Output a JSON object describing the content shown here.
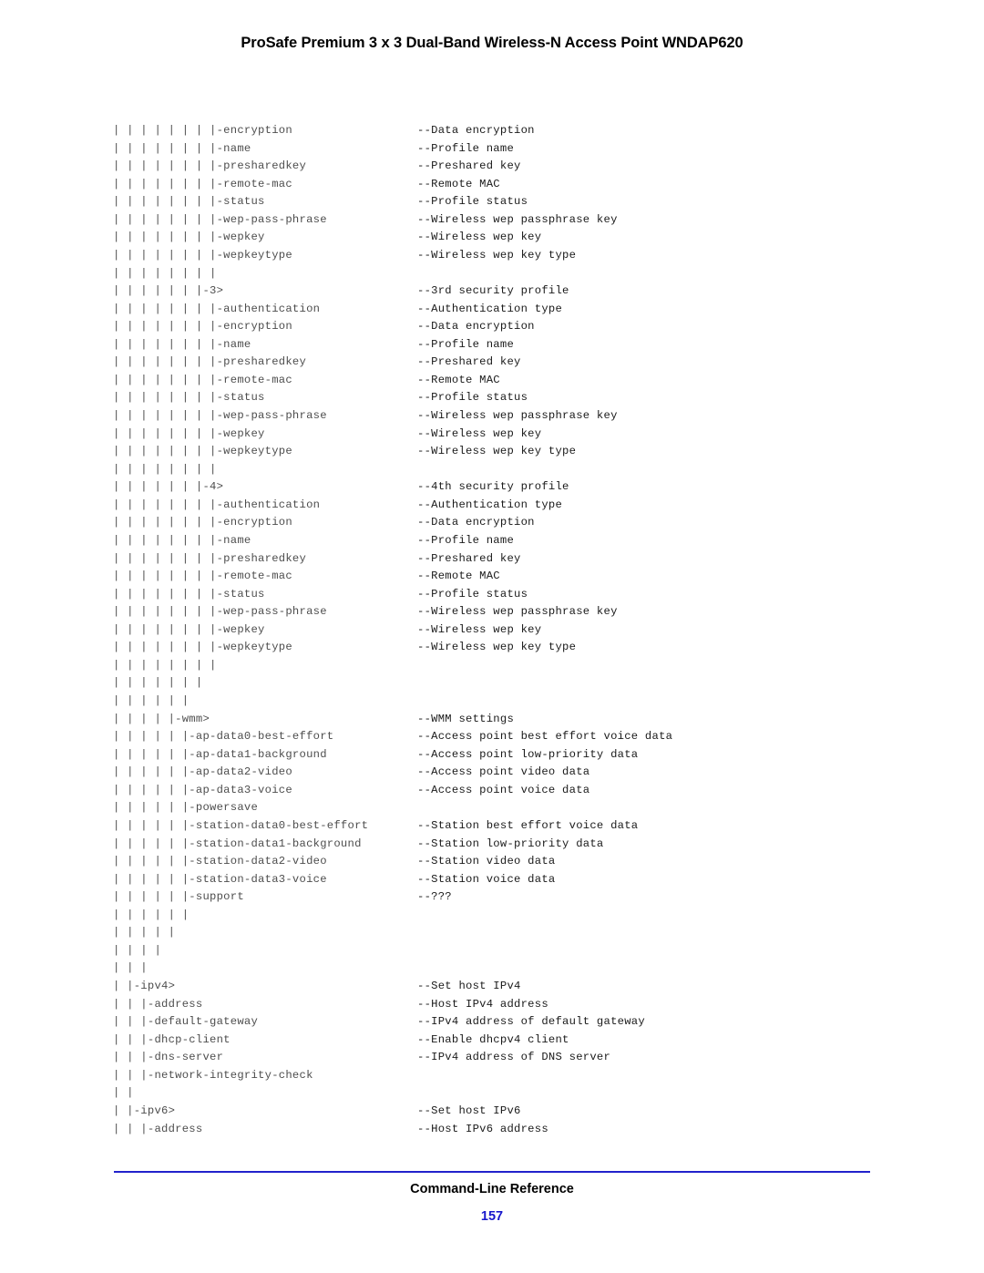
{
  "header": {
    "title": "ProSafe Premium 3 x 3 Dual-Band Wireless-N Access Point WNDAP620"
  },
  "footer": {
    "title": "Command-Line Reference",
    "page_number": "157",
    "rule_color": "#2222cc",
    "page_number_color": "#1717cc"
  },
  "tree": {
    "indent_unit": "| ",
    "branch_prefix": "|",
    "description_prefix": "--",
    "lines": [
      {
        "depth": 8,
        "label": "-encryption",
        "desc": "--Data encryption"
      },
      {
        "depth": 8,
        "label": "-name",
        "desc": "--Profile name"
      },
      {
        "depth": 8,
        "label": "-presharedkey",
        "desc": "--Preshared key"
      },
      {
        "depth": 8,
        "label": "-remote-mac",
        "desc": "--Remote MAC"
      },
      {
        "depth": 8,
        "label": "-status",
        "desc": "--Profile status"
      },
      {
        "depth": 8,
        "label": "-wep-pass-phrase",
        "desc": "--Wireless wep passphrase key"
      },
      {
        "depth": 8,
        "label": "-wepkey",
        "desc": "--Wireless wep key"
      },
      {
        "depth": 8,
        "label": "-wepkeytype",
        "desc": "--Wireless wep key type"
      },
      {
        "depth": 8,
        "label": "",
        "desc": ""
      },
      {
        "depth": 7,
        "label": "-3>",
        "desc": "--3rd security profile"
      },
      {
        "depth": 8,
        "label": "-authentication",
        "desc": "--Authentication type"
      },
      {
        "depth": 8,
        "label": "-encryption",
        "desc": "--Data encryption"
      },
      {
        "depth": 8,
        "label": "-name",
        "desc": "--Profile name"
      },
      {
        "depth": 8,
        "label": "-presharedkey",
        "desc": "--Preshared key"
      },
      {
        "depth": 8,
        "label": "-remote-mac",
        "desc": "--Remote MAC"
      },
      {
        "depth": 8,
        "label": "-status",
        "desc": "--Profile status"
      },
      {
        "depth": 8,
        "label": "-wep-pass-phrase",
        "desc": "--Wireless wep passphrase key"
      },
      {
        "depth": 8,
        "label": "-wepkey",
        "desc": "--Wireless wep key"
      },
      {
        "depth": 8,
        "label": "-wepkeytype",
        "desc": "--Wireless wep key type"
      },
      {
        "depth": 8,
        "label": "",
        "desc": ""
      },
      {
        "depth": 7,
        "label": "-4>",
        "desc": "--4th security profile"
      },
      {
        "depth": 8,
        "label": "-authentication",
        "desc": "--Authentication type"
      },
      {
        "depth": 8,
        "label": "-encryption",
        "desc": "--Data encryption"
      },
      {
        "depth": 8,
        "label": "-name",
        "desc": "--Profile name"
      },
      {
        "depth": 8,
        "label": "-presharedkey",
        "desc": "--Preshared key"
      },
      {
        "depth": 8,
        "label": "-remote-mac",
        "desc": "--Remote MAC"
      },
      {
        "depth": 8,
        "label": "-status",
        "desc": "--Profile status"
      },
      {
        "depth": 8,
        "label": "-wep-pass-phrase",
        "desc": "--Wireless wep passphrase key"
      },
      {
        "depth": 8,
        "label": "-wepkey",
        "desc": "--Wireless wep key"
      },
      {
        "depth": 8,
        "label": "-wepkeytype",
        "desc": "--Wireless wep key type"
      },
      {
        "depth": 8,
        "label": "",
        "desc": ""
      },
      {
        "depth": 7,
        "label": "",
        "desc": ""
      },
      {
        "depth": 6,
        "label": "",
        "desc": ""
      },
      {
        "depth": 5,
        "label": "-wmm>",
        "desc": "--WMM settings"
      },
      {
        "depth": 6,
        "label": "-ap-data0-best-effort",
        "desc": "--Access point best effort voice data"
      },
      {
        "depth": 6,
        "label": "-ap-data1-background",
        "desc": "--Access point low-priority data"
      },
      {
        "depth": 6,
        "label": "-ap-data2-video",
        "desc": "--Access point video data"
      },
      {
        "depth": 6,
        "label": "-ap-data3-voice",
        "desc": "--Access point voice data"
      },
      {
        "depth": 6,
        "label": "-powersave",
        "desc": ""
      },
      {
        "depth": 6,
        "label": "-station-data0-best-effort",
        "desc": "--Station best effort voice data"
      },
      {
        "depth": 6,
        "label": "-station-data1-background",
        "desc": "--Station low-priority data"
      },
      {
        "depth": 6,
        "label": "-station-data2-video",
        "desc": "--Station video data"
      },
      {
        "depth": 6,
        "label": "-station-data3-voice",
        "desc": "--Station voice data"
      },
      {
        "depth": 6,
        "label": "-support",
        "desc": "--???"
      },
      {
        "depth": 6,
        "label": "",
        "desc": ""
      },
      {
        "depth": 5,
        "label": "",
        "desc": ""
      },
      {
        "depth": 4,
        "label": "",
        "desc": ""
      },
      {
        "depth": 3,
        "label": "",
        "desc": ""
      },
      {
        "depth": 2,
        "label": "-ipv4>",
        "desc": "--Set host IPv4"
      },
      {
        "depth": 3,
        "label": "-address",
        "desc": "--Host IPv4 address"
      },
      {
        "depth": 3,
        "label": "-default-gateway",
        "desc": "--IPv4 address of default gateway"
      },
      {
        "depth": 3,
        "label": "-dhcp-client",
        "desc": "--Enable dhcpv4 client"
      },
      {
        "depth": 3,
        "label": "-dns-server",
        "desc": "--IPv4 address of DNS server"
      },
      {
        "depth": 3,
        "label": "-network-integrity-check",
        "desc": ""
      },
      {
        "depth": 2,
        "label": "",
        "desc": ""
      },
      {
        "depth": 2,
        "label": "-ipv6>",
        "desc": "--Set host IPv6"
      },
      {
        "depth": 3,
        "label": "-address",
        "desc": "--Host IPv6 address"
      }
    ]
  }
}
